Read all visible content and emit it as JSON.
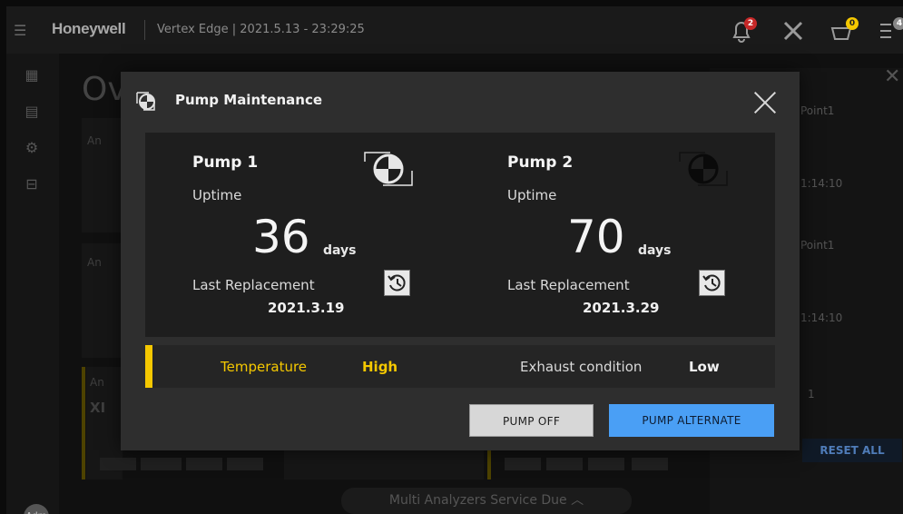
{
  "header": {
    "menu_icon": "hamburger-icon",
    "brand": "Honeywell",
    "subtitle": "Vertex Edge | 2021.5.13 - 23:29:25",
    "notif_badge": "2",
    "alert_badge": "0",
    "list_badge": "4"
  },
  "background": {
    "page_title": "Ov",
    "card_labels": [
      "An",
      "An",
      "An"
    ],
    "card_value": "XI",
    "right_panel_label_1": "Point1",
    "right_panel_time_1": "1:14:10",
    "right_panel_label_2": "Point1",
    "right_panel_time_2": "1:14:10",
    "right_panel_page": "1",
    "reset_all": "RESET ALL",
    "bottom_bar": "Multi Analyzers Service Due",
    "avatar": "Adm"
  },
  "modal": {
    "title": "Pump Maintenance",
    "pumps": [
      {
        "name": "Pump 1",
        "uptime_label": "Uptime",
        "uptime_value": "36",
        "uptime_unit": "days",
        "last_label": "Last Replacement",
        "last_date": "2021.3.19",
        "active": false
      },
      {
        "name": "Pump 2",
        "uptime_label": "Uptime",
        "uptime_value": "70",
        "uptime_unit": "days",
        "last_label": "Last Replacement",
        "last_date": "2021.3.29",
        "active": true
      }
    ],
    "status": {
      "temperature_label": "Temperature",
      "temperature_value": "High",
      "exhaust_label": "Exhaust condition",
      "exhaust_value": "Low"
    },
    "buttons": {
      "pump_off": "PUMP OFF",
      "pump_alternate": "PUMP ALTERNATE"
    }
  },
  "colors": {
    "accent_yellow": "#f5c800",
    "primary_blue": "#4a9ff5",
    "modal_bg": "#2e2e2e",
    "panel_bg": "#1e1e1e"
  }
}
